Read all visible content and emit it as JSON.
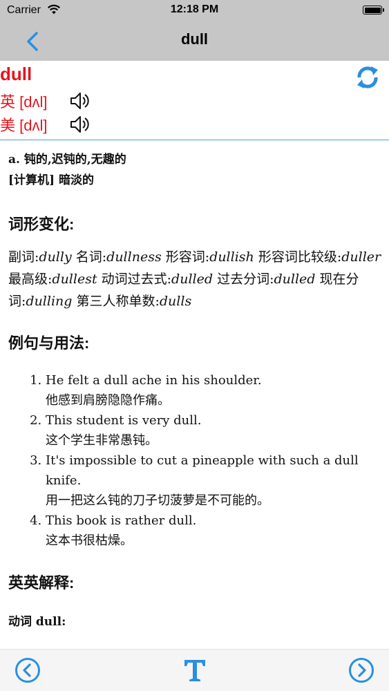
{
  "status_bar": {
    "carrier": "Carrier",
    "time": "12:18 PM"
  },
  "nav": {
    "title": "dull"
  },
  "header": {
    "word": "dull",
    "pron_uk_label": "英 [dʌl]",
    "pron_us_label": "美 [dʌl]"
  },
  "definitions": [
    "a. 钝的,迟钝的,无趣的",
    "[计算机] 暗淡的"
  ],
  "forms_section": {
    "title": "词形变化:",
    "items": [
      {
        "label": "副词:",
        "value": "dully"
      },
      {
        "label": "名词:",
        "value": "dullness"
      },
      {
        "label": "形容词:",
        "value": "dullish"
      },
      {
        "label": "形容词比较级:",
        "value": "duller"
      },
      {
        "label": "最高级:",
        "value": "dullest"
      },
      {
        "label": "动词过去式:",
        "value": "dulled"
      },
      {
        "label": "过去分词:",
        "value": "dulled"
      },
      {
        "label": "现在分词:",
        "value": "dulling"
      },
      {
        "label": "第三人称单数:",
        "value": "dulls"
      }
    ]
  },
  "examples_section": {
    "title": "例句与用法:",
    "items": [
      {
        "en": "He felt a dull ache in his shoulder.",
        "zh": "他感到肩膀隐隐作痛。"
      },
      {
        "en": "This student is very dull.",
        "zh": "这个学生非常愚钝。"
      },
      {
        "en": "It's impossible to cut a pineapple with such a dull knife.",
        "zh": "用一把这么钝的刀子切菠萝是不可能的。"
      },
      {
        "en": "This book is rather dull.",
        "zh": "这本书很枯燥。"
      }
    ]
  },
  "english_section": {
    "title": "英英解释:",
    "first_entry": "动词 dull:"
  },
  "colors": {
    "accent": "#2a8fe0",
    "word_red": "#e8141d",
    "nav_bg": "#c6c6c6"
  },
  "icons": {
    "back": "chevron-left-icon",
    "refresh": "refresh-icon",
    "speaker": "speaker-icon",
    "prev": "circle-chevron-left-icon",
    "font": "font-size-icon",
    "next": "circle-chevron-right-icon"
  }
}
